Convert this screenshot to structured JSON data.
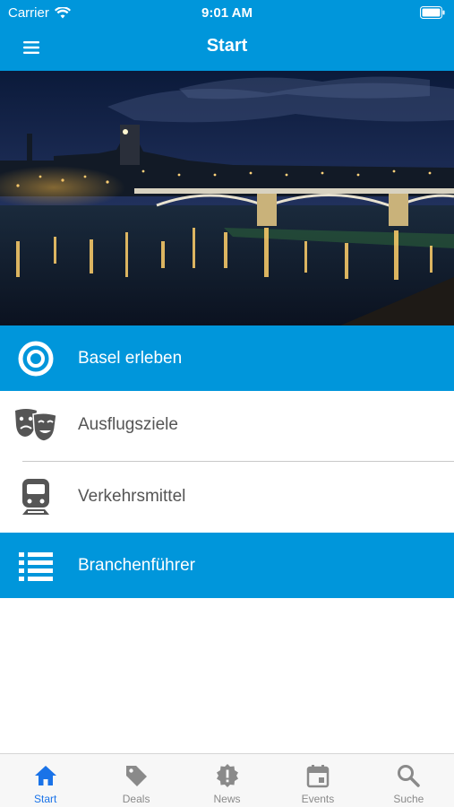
{
  "status": {
    "carrier": "Carrier",
    "time": "9:01 AM"
  },
  "nav": {
    "title": "Start"
  },
  "hero": {
    "alt": ""
  },
  "menu": [
    {
      "label": "Basel erleben",
      "icon": "target-icon"
    },
    {
      "label": "Ausflugsziele",
      "icon": "theater-masks-icon"
    },
    {
      "label": "Verkehrsmittel",
      "icon": "train-icon"
    },
    {
      "label": "Branchenführer",
      "icon": "list-icon"
    }
  ],
  "tabs": [
    {
      "label": "Start",
      "icon": "home-icon",
      "active": true
    },
    {
      "label": "Deals",
      "icon": "tag-icon",
      "active": false
    },
    {
      "label": "News",
      "icon": "alert-badge-icon",
      "active": false
    },
    {
      "label": "Events",
      "icon": "calendar-icon",
      "active": false
    },
    {
      "label": "Suche",
      "icon": "search-icon",
      "active": false
    }
  ],
  "colors": {
    "primary": "#0096db",
    "tab_active": "#1a73e8",
    "tab_inactive": "#8a8a8a",
    "text_gray": "#555555"
  }
}
